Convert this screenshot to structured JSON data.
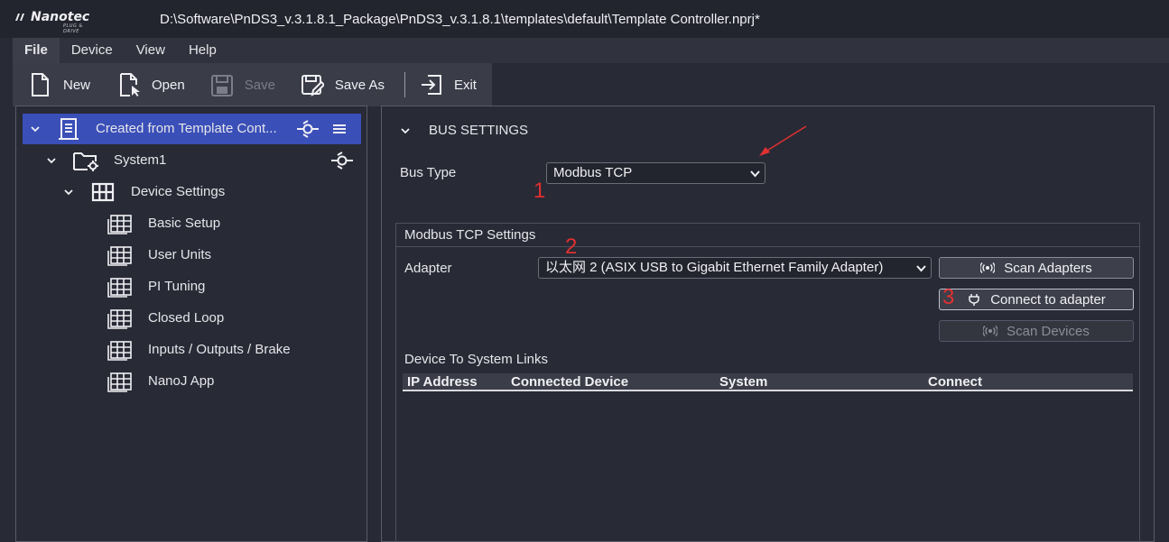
{
  "titlebar": {
    "logo_text": "Nanotec",
    "logo_sub": "PLUG & DRIVE",
    "path": "D:\\Software\\PnDS3_v.3.1.8.1_Package\\PnDS3_v.3.1.8.1\\templates\\default\\Template Controller.nprj*"
  },
  "menu": [
    "File",
    "Device",
    "View",
    "Help"
  ],
  "toolbar": {
    "new": "New",
    "open": "Open",
    "save": "Save",
    "save_as": "Save As",
    "exit": "Exit"
  },
  "tree": {
    "root": "Created from Template Cont...",
    "system": "System1",
    "device_settings": "Device Settings",
    "children": [
      "Basic Setup",
      "User Units",
      "PI Tuning",
      "Closed Loop",
      "Inputs / Outputs / Brake",
      "NanoJ App"
    ]
  },
  "bus": {
    "section_title": "BUS SETTINGS",
    "bus_type_label": "Bus Type",
    "bus_type_value": "Modbus TCP"
  },
  "modbus": {
    "group_title": "Modbus TCP Settings",
    "adapter_label": "Adapter",
    "adapter_value": "以太网 2 (ASIX USB to Gigabit Ethernet Family Adapter)",
    "scan_adapters": "Scan Adapters",
    "connect_adapter": "Connect to adapter",
    "scan_devices": "Scan Devices",
    "links_label": "Device To System Links",
    "columns": [
      "IP Address",
      "Connected Device",
      "System",
      "Connect"
    ]
  },
  "annotations": [
    "1",
    "2",
    "3"
  ],
  "colors": {
    "background": "#282a36",
    "selection": "#3a4fb8",
    "annotation_red": "#e03030"
  }
}
